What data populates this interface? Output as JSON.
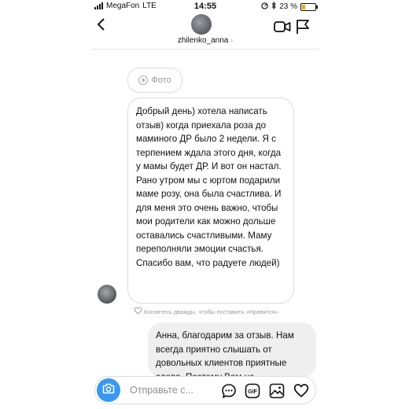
{
  "status_bar": {
    "carrier": "MegaFon",
    "network": "LTE",
    "time": "14:55",
    "battery_percent": "23 %",
    "battery_level": 0.23,
    "battery_color": "#f0a800"
  },
  "header": {
    "username": "zhilenko_anna",
    "chevron": "›",
    "back_icon": "chevron-left-icon",
    "call_icon": "video-camera-icon",
    "info_icon": "flag-icon"
  },
  "chat": {
    "photo_label": "Фото",
    "incoming_message": "Добрый день) хотела написать отзыв) когда приехала роза до маминого ДР было 2 недели. Я с терпением ждала этого дня, когда у мамы будет ДР. И вот он настал. Рано утром мы с юртом подарили маме розу, она была счастлива. И для меня это очень важно, чтобы мои родители как можно дольше оставались счастливыми. Маму переполняли эмоции счастья. Спасибо вам, что радуете людей)",
    "like_hint": "Коснитесь дважды, чтобы поставить «Нравится»",
    "outgoing_message": "Анна, благодарим за отзыв. Нам всегда приятно слышать от довольных клиентов приятные слова. Поэтому Вам не"
  },
  "input_bar": {
    "placeholder": "Отправьте с...",
    "accent_color": "#3897f0",
    "icons": [
      "camera-icon",
      "speech-bubble-icon",
      "gif-icon",
      "image-icon",
      "heart-icon"
    ],
    "gif_label": "GIF"
  }
}
